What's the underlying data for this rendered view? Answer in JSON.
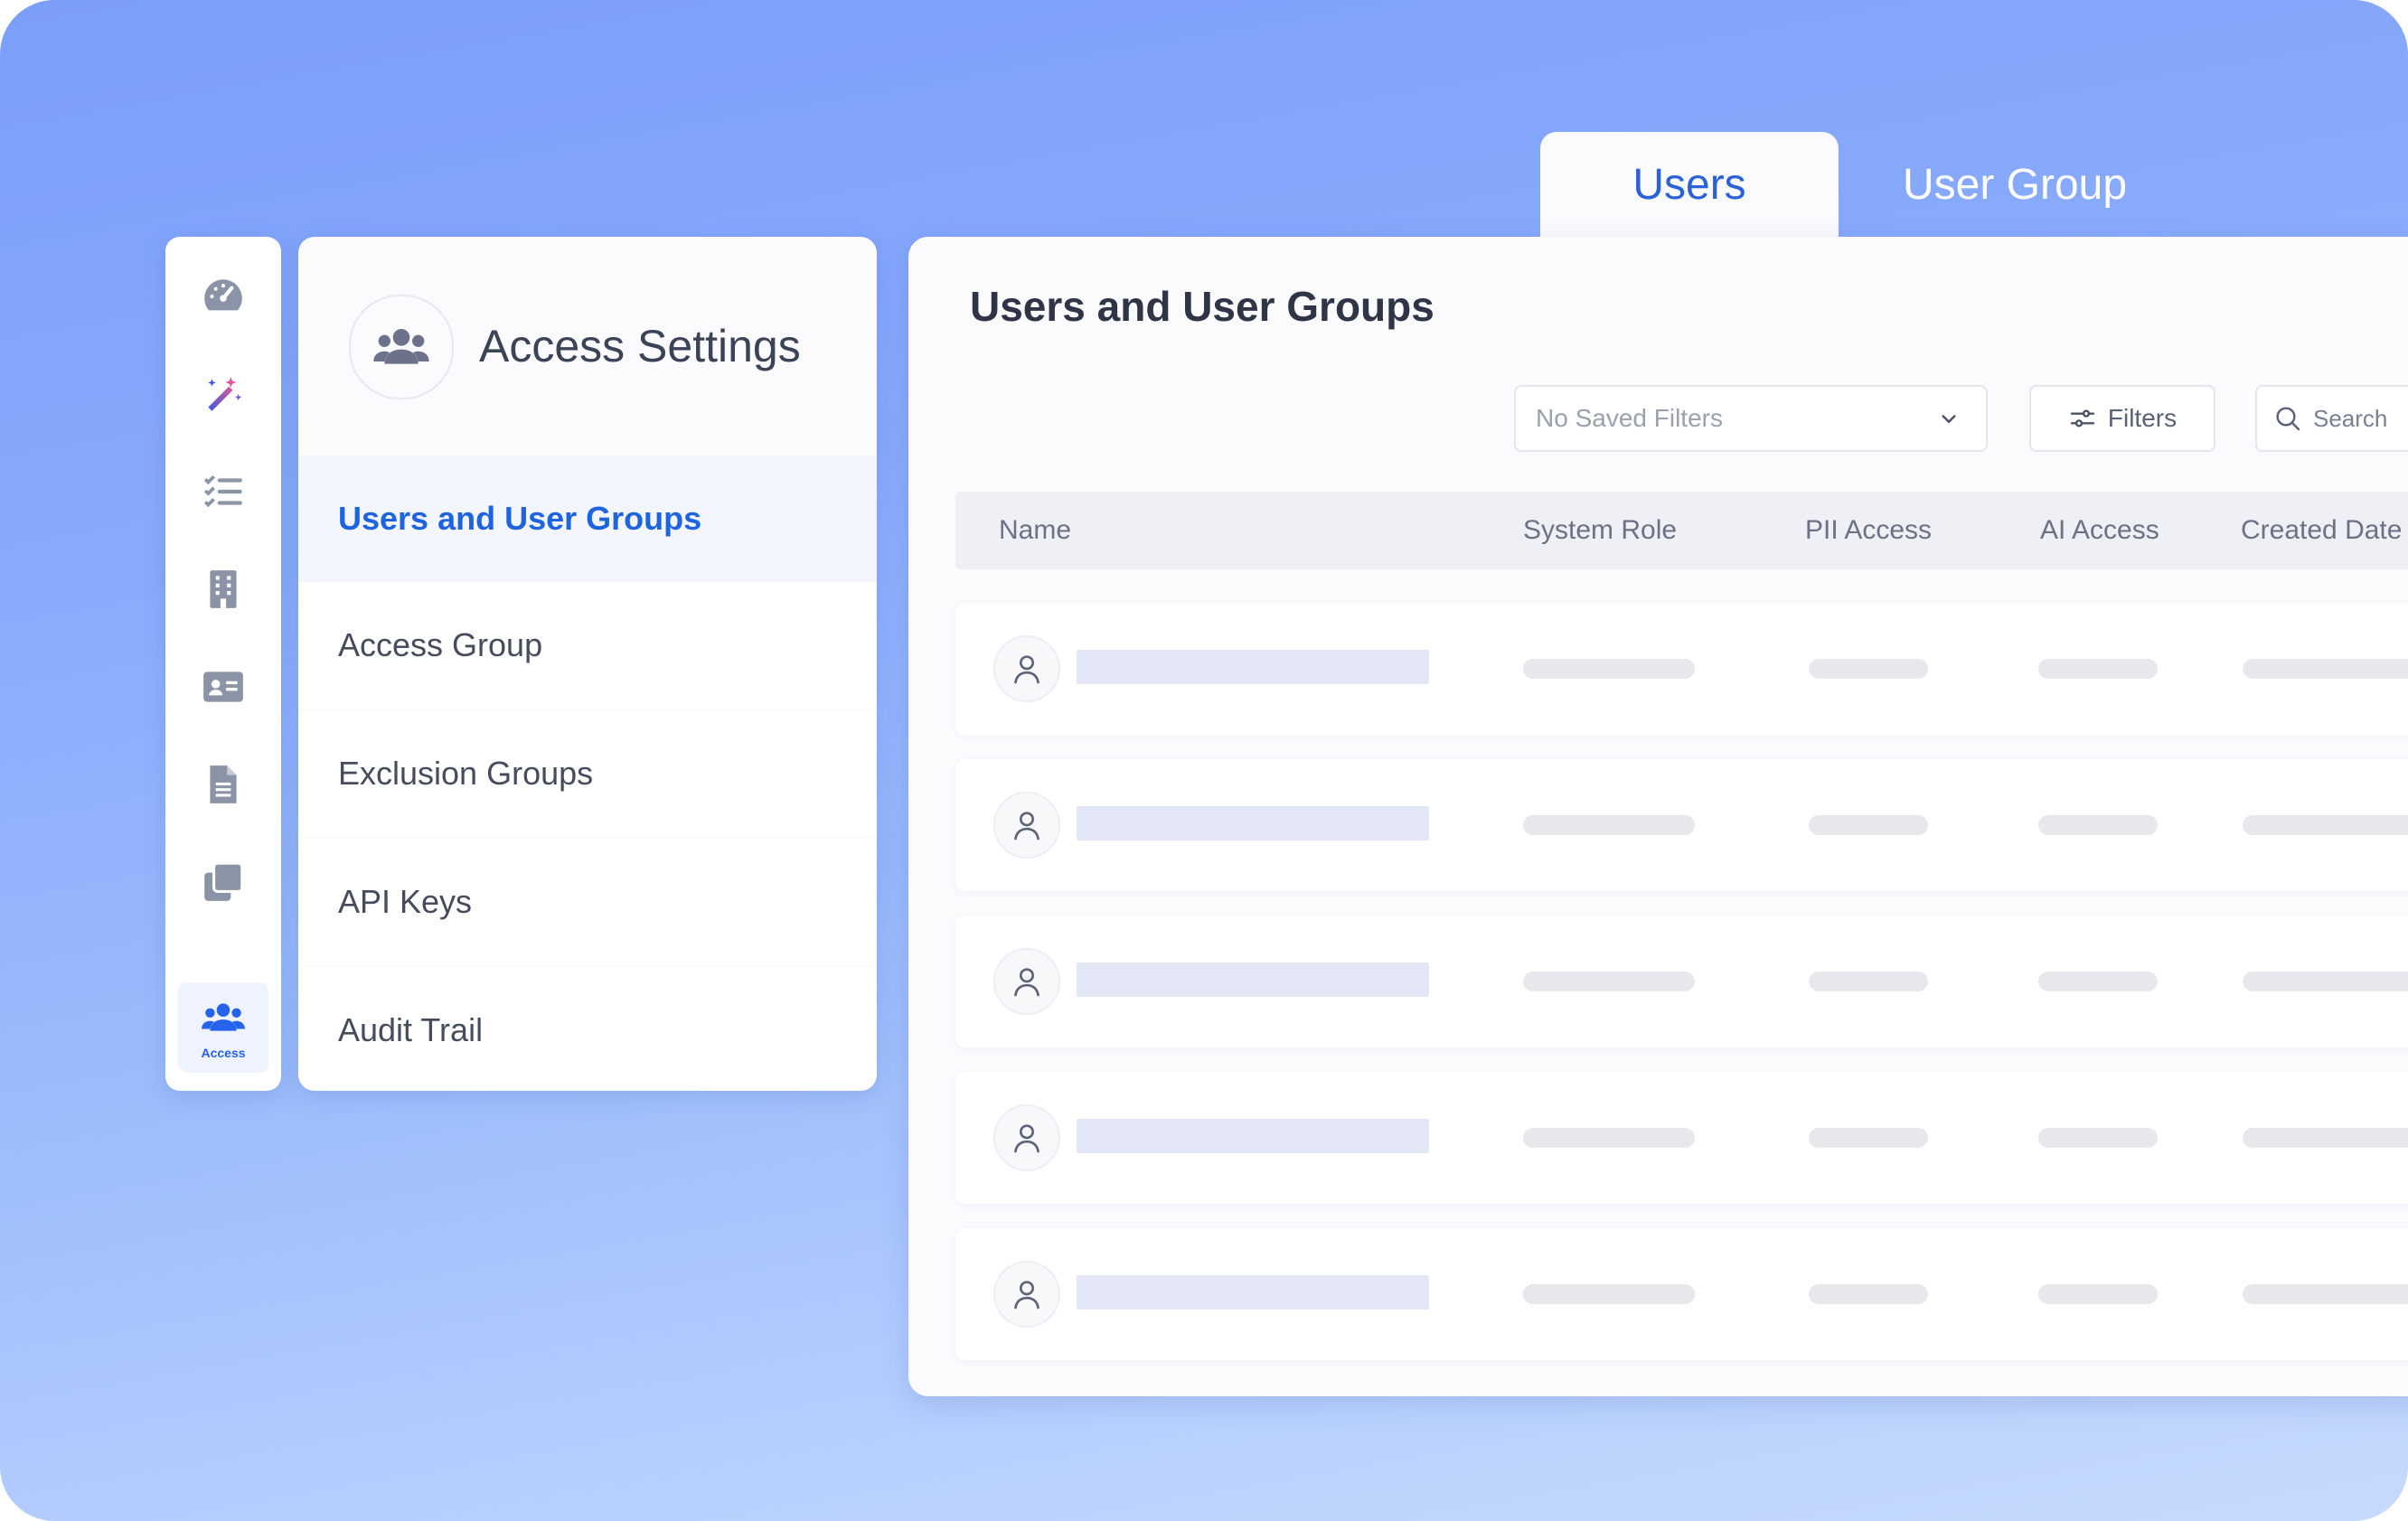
{
  "tabs": [
    {
      "label": "Users",
      "active": true
    },
    {
      "label": "User Group",
      "active": false
    }
  ],
  "rail": {
    "items": [
      {
        "icon": "dashboard-gauge-icon"
      },
      {
        "icon": "magic-wand-icon"
      },
      {
        "icon": "checklist-icon"
      },
      {
        "icon": "building-icon"
      },
      {
        "icon": "id-card-icon"
      },
      {
        "icon": "document-icon"
      },
      {
        "icon": "copy-icon"
      },
      {
        "icon": "users-icon",
        "label": "Access",
        "active": true
      }
    ]
  },
  "nav": {
    "title": "Access Settings",
    "icon": "users-group-icon",
    "items": [
      {
        "label": "Users and User Groups",
        "active": true
      },
      {
        "label": "Access Group"
      },
      {
        "label": "Exclusion Groups"
      },
      {
        "label": "API Keys"
      },
      {
        "label": "Audit Trail"
      }
    ]
  },
  "main": {
    "title": "Users and User Groups",
    "saved_filters": "No Saved Filters",
    "filters_label": "Filters",
    "search_placeholder": "Search",
    "columns": [
      "Name",
      "System Role",
      "PII Access",
      "AI Access",
      "Created Date"
    ]
  },
  "colors": {
    "accent": "#2563eb",
    "background_top": "#7b9ef9",
    "background_bottom": "#c7dafd"
  }
}
